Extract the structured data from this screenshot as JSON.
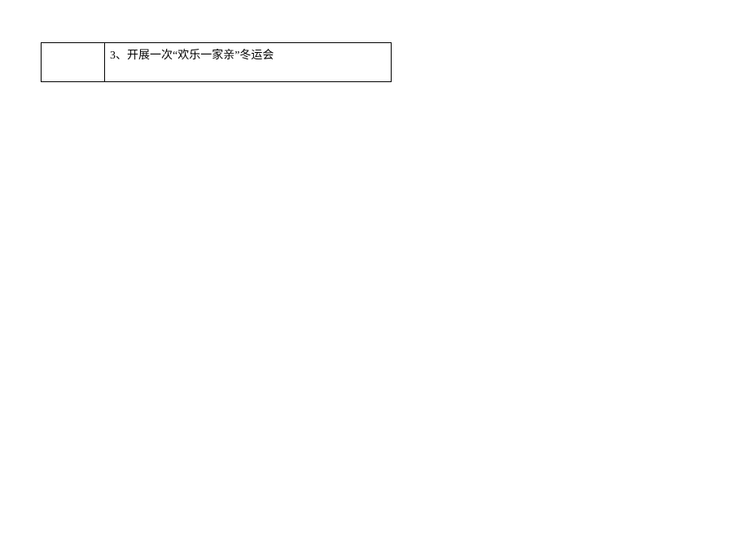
{
  "table": {
    "rows": [
      {
        "col1": "",
        "col2": "3、开展一次“欢乐一家亲”冬运会"
      }
    ]
  }
}
